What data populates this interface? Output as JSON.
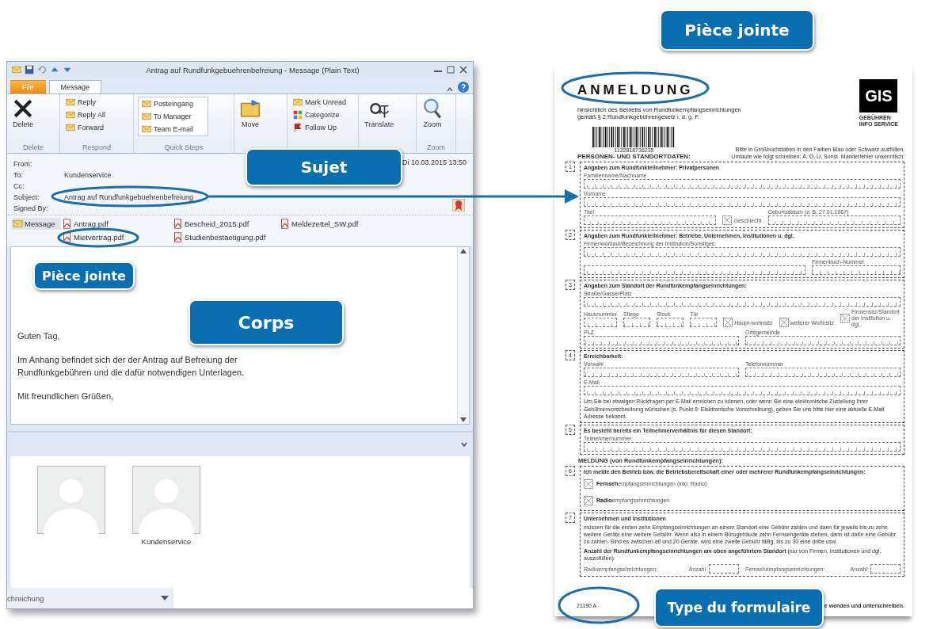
{
  "email_window": {
    "title": "Antrag auf Rundfunkgebuehrenbefreiung  -  Message (Plain Text)",
    "tabs": [
      {
        "label": "File",
        "selected": false
      },
      {
        "label": "Message",
        "selected": true
      }
    ],
    "ribbon_groups": [
      {
        "label": "Delete",
        "buttons": [
          {
            "label": "Delete",
            "kind": "large"
          }
        ]
      },
      {
        "label": "Respond",
        "buttons": [
          {
            "label": "Reply",
            "kind": "small"
          },
          {
            "label": "Reply All",
            "kind": "small"
          },
          {
            "label": "Forward",
            "kind": "small"
          }
        ]
      },
      {
        "label": "Quick Steps",
        "buttons": [
          {
            "label": "Posteingang",
            "kind": "small"
          },
          {
            "label": "To Manager",
            "kind": "small"
          },
          {
            "label": "Team E-mail",
            "kind": "small"
          }
        ]
      },
      {
        "buttons": [
          {
            "label": "Move",
            "kind": "large"
          }
        ]
      },
      {
        "buttons": [
          {
            "label": "Mark Unread",
            "kind": "small"
          },
          {
            "label": "Categorize",
            "kind": "small"
          },
          {
            "label": "Follow Up",
            "kind": "small"
          }
        ]
      },
      {
        "buttons": [
          {
            "label": "Translate",
            "kind": "large"
          }
        ]
      },
      {
        "label": "Zoom",
        "buttons": [
          {
            "label": "Zoom",
            "kind": "large"
          }
        ]
      }
    ],
    "header_fields": [
      {
        "label": "From:"
      },
      {
        "label": "To:",
        "value": "Kundenservice"
      },
      {
        "label": "Cc:"
      },
      {
        "label": "Subject:",
        "value": "Antrag auf Rundfunkgebuehrenbefreiung"
      },
      {
        "label": "Signed By:"
      }
    ],
    "sent": "Di 10.03.2015 13:50",
    "attachments": [
      {
        "label": "Message",
        "kind": "message",
        "selected": true
      },
      {
        "label": "Antrag.pdf",
        "kind": "pdf",
        "selected": false
      },
      {
        "label": "Bescheid_2015.pdf",
        "kind": "pdf",
        "selected": false
      },
      {
        "label": "Meldezettel_SW.pdf",
        "kind": "pdf",
        "selected": false
      },
      {
        "label": "Mietvertrag.pdf",
        "kind": "pdf",
        "selected": false
      },
      {
        "label": "Studienbestaetigung.pdf",
        "kind": "pdf",
        "selected": false
      }
    ],
    "body": [
      "Guten Tag,",
      "Im Anhang befindet sich der der Antrag auf Befreiung der Rundfunkgebühren und die dafür notwendigen Unterlagen.",
      "Mit freundlichen Grüßen,"
    ],
    "contacts": [
      {
        "kind": "unnamed"
      },
      {
        "kind": "named",
        "name": "Kundenservice"
      }
    ],
    "bottom_field": "chreichung"
  },
  "form": {
    "title": "ANMELDUNG",
    "subtitle": [
      "hinsichtlich des Betriebs von Rundfunkempfangseinrichtungen",
      "gemäß § 2 Rundfunkgebührengesetz i. d. g. F."
    ],
    "logo": "GIS",
    "logo_caption": [
      "GEBÜHREN",
      "INFO SERVICE"
    ],
    "barcode_number": "1122818736235",
    "heading": "PERSONEN- UND STANDORTDATEN:",
    "instructions": [
      "Bitte in Großbuchstaben in den Farben Blau oder Schwarz ausfüllen.",
      "Umlaute wie folgt schreiben: Ä, Ö, Ü, Sonst. Markierfehler unkenntlich:"
    ],
    "sections": [
      {
        "number": "1",
        "heading": "Angaben zum Rundfunkteilnehmer: Privatpersonen",
        "blocks": [
          {
            "kind": "fields",
            "fields": [
              {
                "label": "Familienname/Nachname"
              }
            ]
          },
          {
            "kind": "fields",
            "fields": [
              {
                "label": "Vorname"
              }
            ]
          },
          {
            "kind": "fields",
            "fields": [
              {
                "label": "Titel"
              },
              {
                "label": "Geschlecht",
                "kind": "markers"
              },
              {
                "label": "Geburtsdatum (z. B. 27.01.1967)"
              }
            ]
          }
        ]
      },
      {
        "number": "2",
        "heading": "Angaben zum Rundfunkteilnehmer: Betriebe, Unternehmen, Institutionen u. dgl.",
        "blocks": [
          {
            "kind": "fields",
            "fields": [
              {
                "label": "Firmenwortlaut/Bezeichnung der Institution/Sonstiges"
              }
            ]
          },
          {
            "kind": "fields",
            "fields": [
              {
                "kind": "blank"
              },
              {
                "label": "Firmenbuch-Nummer"
              }
            ]
          }
        ]
      },
      {
        "number": "3",
        "heading": "Angaben zum Standort der Rundfunkempfangseinrichtungen:",
        "blocks": [
          {
            "kind": "fields",
            "fields": [
              {
                "label": "Straße/Gasse/Platz"
              }
            ]
          },
          {
            "kind": "fields",
            "fields": [
              {
                "label": "Hausnummer"
              },
              {
                "label": "Stiege"
              },
              {
                "label": "Stock"
              },
              {
                "label": "Tür"
              },
              {
                "label": "Haupt-wohnsitz",
                "kind": "markers"
              },
              {
                "label": "weiterer Wohnsitz",
                "kind": "markers"
              },
              {
                "label": "Firmensitz/Standort der Institution u. dgl.",
                "kind": "markers"
              }
            ]
          },
          {
            "kind": "fields",
            "fields": [
              {
                "label": "PLZ"
              },
              {
                "label": "Ortsgemeinde"
              }
            ]
          }
        ]
      },
      {
        "number": "4",
        "heading": "Erreichbarkeit:",
        "blocks": [
          {
            "kind": "fields",
            "fields": [
              {
                "label": "Vorwahl"
              },
              {
                "label": "Telefonnummer"
              }
            ]
          },
          {
            "kind": "fields",
            "fields": [
              {
                "label": "E-Mail"
              }
            ]
          },
          {
            "kind": "note",
            "text": "Um Sie bei etwaigen Rückfragen per E-Mail erreichen zu können, oder wenn Sie eine elektronische Zustellung Ihrer Gebührenvorschreibung wünschen (s. Punkt 9: Elektronische Vorschreibung), geben Sie uns bitte hier eine aktuelle E-Mail Adresse bekannt."
          }
        ]
      },
      {
        "number": "5",
        "heading": "Es besteht bereits ein Teilnehmerverhältnis für diesen Standort:",
        "blocks": [
          {
            "kind": "fields",
            "fields": [
              {
                "label": "Teilnehmernummer:"
              }
            ]
          }
        ]
      },
      {
        "number": "6",
        "pre_heading": "MELDUNG (von Rundfunkempfangseinrichtungen):",
        "heading": "Ich melde den Betrieb bzw. die Betriebsbereitschaft einer oder mehrerer Rundfunkempfangseinrichtungen:",
        "blocks": [
          {
            "kind": "option",
            "text": "**Fernseh**empfangseinrichtungen (inkl. Radio)"
          },
          {
            "kind": "option",
            "text": "**Radio**empfangseinrichtungen"
          }
        ]
      },
      {
        "number": "7",
        "heading": "Unternehmen und Institutionen",
        "blocks": [
          {
            "kind": "note",
            "text": "müssen für die ersten zehn Empfangseinrichtungen an einem Standort eine Gebühr zahlen und dann für jeweils bis zu zehn weitere Geräte eine weitere Gebühr. Wenn also in einem Bürogebäude zehn Fernsehgeräte stehen, dann ist dafür eine Gebühr zu zahlen. Sind es zwischen elf und 20 Geräte, wird eine zweite Gebühr fällig, bis zu 30 eine dritte usw."
          },
          {
            "kind": "note",
            "text": "**Anzahl der Rundfunkempfangseinrichtungen am oben angeführtem Standort** (nur von Firmen, Institutionen und dgl. auszufüllen):"
          },
          {
            "kind": "counts",
            "fields": [
              {
                "label": "Radioempfangseinrichtungen:",
                "count_label": "Anzahl"
              },
              {
                "label": "Fernsehempfangseinrichtungen:",
                "count_label": "Anzahl"
              }
            ]
          }
        ]
      }
    ],
    "form_code": "21190 A",
    "footer_note": "e wenden und unterschreiben."
  },
  "callouts": [
    {
      "label": "Pièce jointe"
    },
    {
      "label": "Sujet"
    },
    {
      "label": "Pièce jointe"
    },
    {
      "label": "Corps"
    },
    {
      "label": "Type du formulaire"
    }
  ]
}
